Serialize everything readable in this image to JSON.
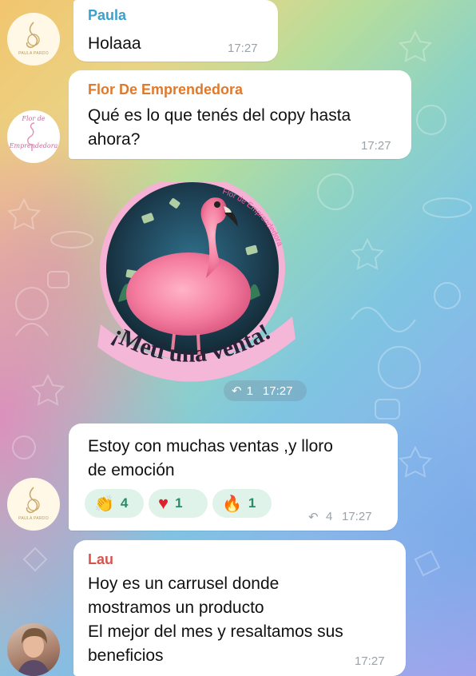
{
  "messages": [
    {
      "sender": "Paula",
      "text": "Holaaa",
      "time": "17:27"
    },
    {
      "sender": "Flor De Emprendedora",
      "text_lines": [
        "Qué es lo que tenés del copy hasta",
        "ahora?"
      ],
      "time": "17:27"
    },
    {
      "sticker_caption": "¡Metí una venta!",
      "sticker_arc_text": "Flor de Emprendedora",
      "reply_count": "1",
      "time": "17:27"
    },
    {
      "text_lines": [
        "Estoy con muchas ventas ,y lloro",
        "de emoción"
      ],
      "reactions": [
        {
          "icon": "clapping-hands-icon",
          "count": "4"
        },
        {
          "icon": "heart-icon",
          "count": "1"
        },
        {
          "icon": "fire-icon",
          "count": "1"
        }
      ],
      "reply_count": "4",
      "time": "17:27"
    },
    {
      "sender": "Lau",
      "text_lines": [
        "Hoy es un carrusel donde",
        "mostramos un producto",
        "El mejor del mes y resaltamos sus",
        "beneficios"
      ],
      "time": "17:27"
    }
  ],
  "avatars": {
    "paula_logo_text": "PAULA PARDO",
    "flor_logo_lines": [
      "Flor de",
      "Emprendedora"
    ]
  },
  "colors": {
    "paula_name": "#3aa0cf",
    "flor_name": "#e07a2a",
    "lau_name": "#d9534f",
    "caption_bg": "#f4b7d8",
    "caption_text": "#2a2238"
  }
}
